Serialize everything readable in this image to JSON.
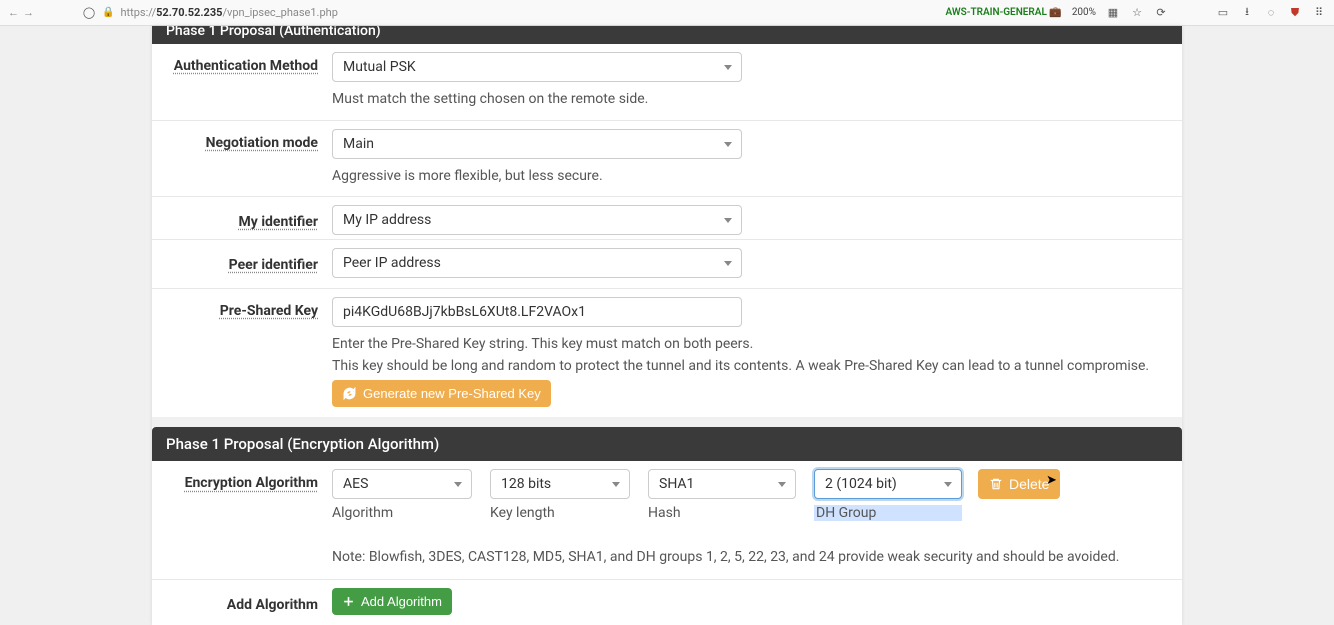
{
  "browser": {
    "url_prefix": "https://",
    "url_host": "52.70.52.235",
    "url_path": "/vpn_ipsec_phase1.php",
    "right_badge": "AWS-TRAIN-GENERAL",
    "zoom": "200%"
  },
  "truncated_header": "Phase 1 Proposal (Authentication)",
  "fields": {
    "auth_method": {
      "label": "Authentication Method",
      "value": "Mutual PSK",
      "help": "Must match the setting chosen on the remote side."
    },
    "negotiation_mode": {
      "label": "Negotiation mode",
      "value": "Main",
      "help": "Aggressive is more flexible, but less secure."
    },
    "my_identifier": {
      "label": "My identifier",
      "value": "My IP address"
    },
    "peer_identifier": {
      "label": "Peer identifier",
      "value": "Peer IP address"
    },
    "psk": {
      "label": "Pre-Shared Key",
      "value": "pi4KGdU68BJj7kbBsL6XUt8.LF2VAOx1",
      "help1": "Enter the Pre-Shared Key string. This key must match on both peers.",
      "help2": "This key should be long and random to protect the tunnel and its contents. A weak Pre-Shared Key can lead to a tunnel compromise.",
      "button": "Generate new Pre-Shared Key"
    }
  },
  "encryption_header": "Phase 1 Proposal (Encryption Algorithm)",
  "encryption": {
    "label": "Encryption Algorithm",
    "algorithm": {
      "value": "AES",
      "sublabel": "Algorithm"
    },
    "keylength": {
      "value": "128 bits",
      "sublabel": "Key length"
    },
    "hash": {
      "value": "SHA1",
      "sublabel": "Hash"
    },
    "dhgroup": {
      "value": "2 (1024 bit)",
      "sublabel": "DH Group"
    },
    "delete_label": "Delete",
    "note": "Note: Blowfish, 3DES, CAST128, MD5, SHA1, and DH groups 1, 2, 5, 22, 23, and 24 provide weak security and should be avoided."
  },
  "add_algo": {
    "label": "Add Algorithm",
    "button": "Add Algorithm"
  }
}
